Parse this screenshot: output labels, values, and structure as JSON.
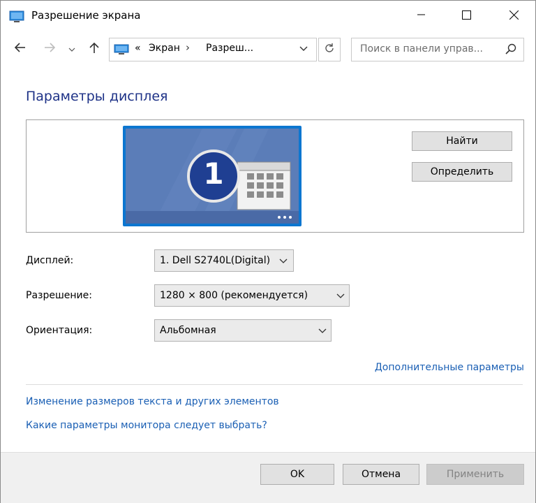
{
  "window": {
    "title": "Разрешение экрана"
  },
  "address": {
    "chevron": "«",
    "segments": [
      "Экран",
      "Разреш..."
    ],
    "separator": "›"
  },
  "search": {
    "placeholder": "Поиск в панели управ..."
  },
  "main": {
    "heading": "Параметры дисплея",
    "monitor_number": "1",
    "find_button": "Найти",
    "identify_button": "Определить",
    "display_label": "Дисплей:",
    "display_value": "1. Dell S2740L(Digital)",
    "resolution_label": "Разрешение:",
    "resolution_value": "1280 × 800 (рекомендуется)",
    "orientation_label": "Ориентация:",
    "orientation_value": "Альбомная",
    "advanced_link": "Дополнительные параметры",
    "text_size_link": "Изменение размеров текста и других элементов",
    "monitor_help_link": "Какие параметры монитора следует выбрать?"
  },
  "footer": {
    "ok": "OK",
    "cancel": "Отмена",
    "apply": "Применить"
  },
  "colors": {
    "accent_text": "#1e3287",
    "link": "#1a5fb4",
    "monitor_frame": "#0c76d0",
    "monitor_screen": "#5b7db8"
  },
  "icons": [
    "monitor-icon",
    "minimize-icon",
    "maximize-icon",
    "close-icon",
    "back-arrow-icon",
    "forward-arrow-icon",
    "recent-chevron-icon",
    "up-arrow-icon",
    "refresh-icon",
    "search-icon"
  ]
}
